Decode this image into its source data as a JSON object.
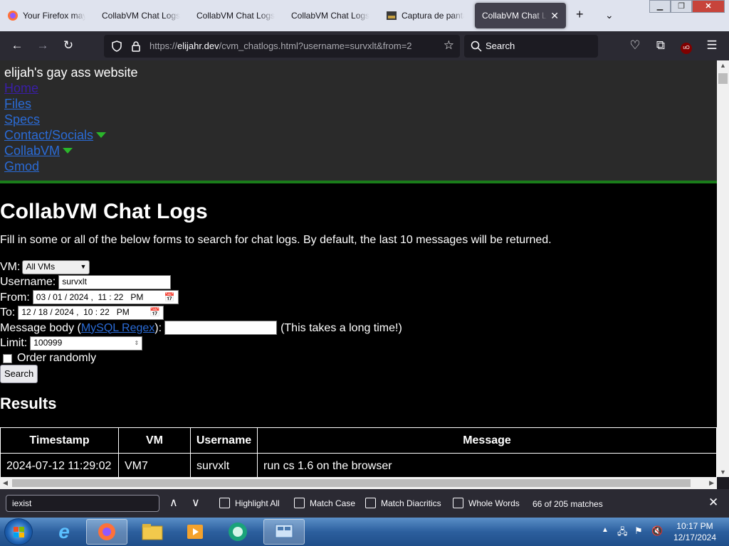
{
  "browser": {
    "tabs": [
      {
        "title": "Your Firefox may",
        "active": false
      },
      {
        "title": "CollabVM Chat Logs",
        "active": false
      },
      {
        "title": "CollabVM Chat Logs",
        "active": false
      },
      {
        "title": "CollabVM Chat Logs",
        "active": false
      },
      {
        "title": "Captura de pantalla",
        "active": false
      },
      {
        "title": "CollabVM Chat Logs",
        "active": true
      }
    ],
    "url_prefix": "https://",
    "url_host": "elijahr.dev",
    "url_path": "/cvm_chatlogs.html?username=survxlt&from=2",
    "search_placeholder": "Search"
  },
  "site": {
    "name": "elijah's gay ass website",
    "nav": [
      {
        "label": "Home",
        "visited": true,
        "dropdown": false
      },
      {
        "label": "Files",
        "visited": false,
        "dropdown": false
      },
      {
        "label": "Specs",
        "visited": false,
        "dropdown": false
      },
      {
        "label": "Contact/Socials",
        "visited": false,
        "dropdown": true
      },
      {
        "label": "CollabVM",
        "visited": false,
        "dropdown": true
      },
      {
        "label": "Gmod",
        "visited": false,
        "dropdown": false
      }
    ]
  },
  "page": {
    "title": "CollabVM Chat Logs",
    "intro": "Fill in some or all of the below forms to search for chat logs. By default, the last 10 messages will be returned.",
    "form": {
      "vm_label": "VM:",
      "vm_value": "All VMs",
      "username_label": "Username:",
      "username_value": "survxlt",
      "from_label": "From:",
      "from_value": "03 / 01 / 2024 ,  11 : 22   PM",
      "to_label": "To:",
      "to_value": "12 / 18 / 2024 ,  10 : 22   PM",
      "message_label_pre": "Message body (",
      "message_link": "MySQL Regex",
      "message_label_post": "):",
      "message_value": "",
      "message_note": "(This takes a long time!)",
      "limit_label": "Limit:",
      "limit_value": "100999",
      "random_label": "Order randomly",
      "search_button": "Search"
    },
    "results_title": "Results",
    "table": {
      "headers": [
        "Timestamp",
        "VM",
        "Username",
        "Message"
      ],
      "rows": [
        [
          "2024-07-12 11:29:02",
          "VM7",
          "survxlt",
          "run cs 1.6 on the browser"
        ]
      ]
    }
  },
  "findbar": {
    "query": "iexist",
    "highlight_all": "Highlight All",
    "match_case": "Match Case",
    "match_diacritics": "Match Diacritics",
    "whole_words": "Whole Words",
    "status": "66 of 205 matches"
  },
  "taskbar": {
    "time": "10:17 PM",
    "date": "12/17/2024"
  },
  "colors": {
    "link": "#2a6bd6",
    "visited_link": "#3a1ea8",
    "header_accent": "#1a7c1a",
    "dropdown_arrow": "#2ab52a"
  }
}
